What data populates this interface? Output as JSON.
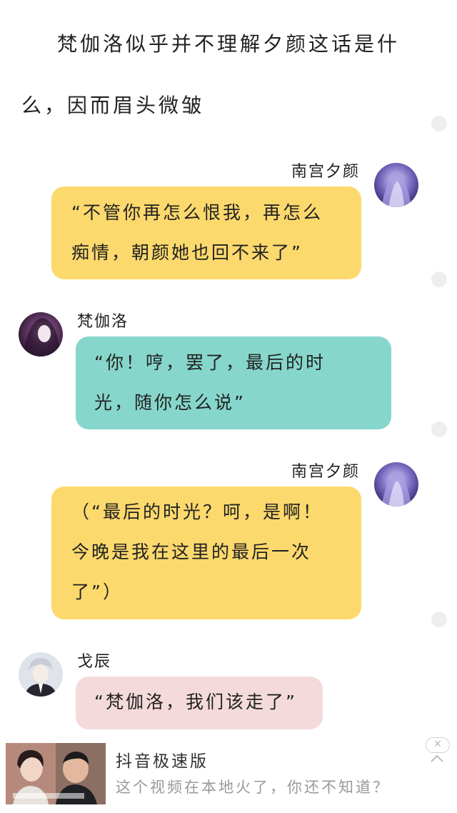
{
  "narration": {
    "line1": "梵伽洛似乎并不理解夕颜这话是什",
    "line2": "么，因而眉头微皱"
  },
  "messages": [
    {
      "name": "南宫夕颜",
      "text": "“不管你再怎么恨我，再怎么\n痴情，朝颜她也回不来了”"
    },
    {
      "name": "梵伽洛",
      "text": "“你！哼，罢了，最后的时\n光，随你怎么说”"
    },
    {
      "name": "南宫夕颜",
      "text": "（“最后的时光？呵，是啊！\n今晚是我在这里的最后一次\n了”）"
    },
    {
      "name": "戈辰",
      "text": "“梵伽洛，我们该走了”"
    }
  ],
  "ad": {
    "title": "抖音极速版",
    "subtitle": "这个视频在本地火了，你还不知道？",
    "close_label": "✕"
  },
  "colors": {
    "yellow_bubble": "#fcd96d",
    "teal_bubble": "#86d6cb",
    "pink_bubble": "#f4dada"
  }
}
